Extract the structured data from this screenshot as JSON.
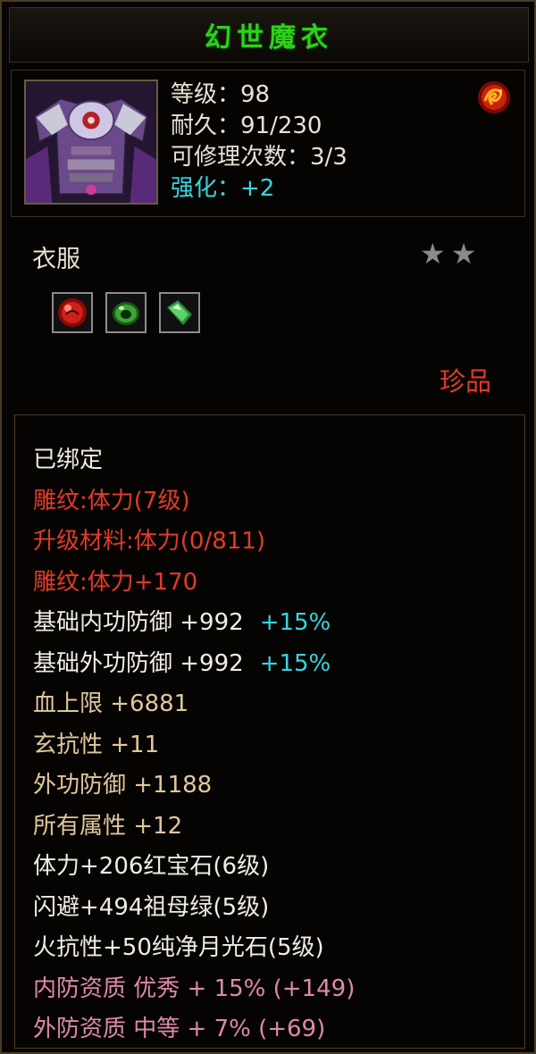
{
  "item": {
    "name": "幻世魔衣",
    "stats": {
      "level": "等级：98",
      "durability": "耐久：91/230",
      "repair_count": "可修理次数：3/3",
      "enhance": "强化：+2"
    },
    "type": "衣服",
    "stars": 2,
    "rarity": "珍品"
  },
  "sockets": [
    {
      "icon": "red-round-gem-icon",
      "color": "#c8221e"
    },
    {
      "icon": "green-ring-gem-icon",
      "color": "#2e9a2a"
    },
    {
      "icon": "green-crystal-gem-icon",
      "color": "#3fb44a"
    }
  ],
  "attributes": [
    {
      "text": "已绑定",
      "color": "white"
    },
    {
      "text": "雕纹:体力(7级)",
      "color": "red"
    },
    {
      "text": "升级材料:体力(0/811)",
      "color": "red"
    },
    {
      "text": "雕纹:体力+170",
      "color": "red"
    },
    {
      "text": "基础内功防御 +992",
      "extra": "+15%",
      "color": "white"
    },
    {
      "text": "基础外功防御 +992",
      "extra": "+15%",
      "color": "white"
    },
    {
      "text": "血上限 +6881",
      "color": "tan"
    },
    {
      "text": "玄抗性 +11",
      "color": "tan"
    },
    {
      "text": "外功防御 +1188",
      "color": "tan"
    },
    {
      "text": "所有属性 +12",
      "color": "tan"
    },
    {
      "text": "体力+206红宝石(6级)",
      "color": "white"
    },
    {
      "text": "闪避+494祖母绿(5级)",
      "color": "white"
    },
    {
      "text": "火抗性+50纯净月光石(5级)",
      "color": "white"
    },
    {
      "text": "内防资质 优秀 + 15% (+149)",
      "color": "pink"
    },
    {
      "text": "外防资质 中等 + 7% (+69)",
      "color": "pink"
    }
  ],
  "colors": {
    "title": "#2fd11a",
    "enhance": "#38d6e0",
    "rarity": "#e23a2a",
    "bound": "#f0ede4",
    "carving": "#e23a2a",
    "base_stat": "#e0c89a",
    "aptitude": "#dd8aa8",
    "bonus_percent": "#35d7e2",
    "star": "#8a8a8a"
  }
}
